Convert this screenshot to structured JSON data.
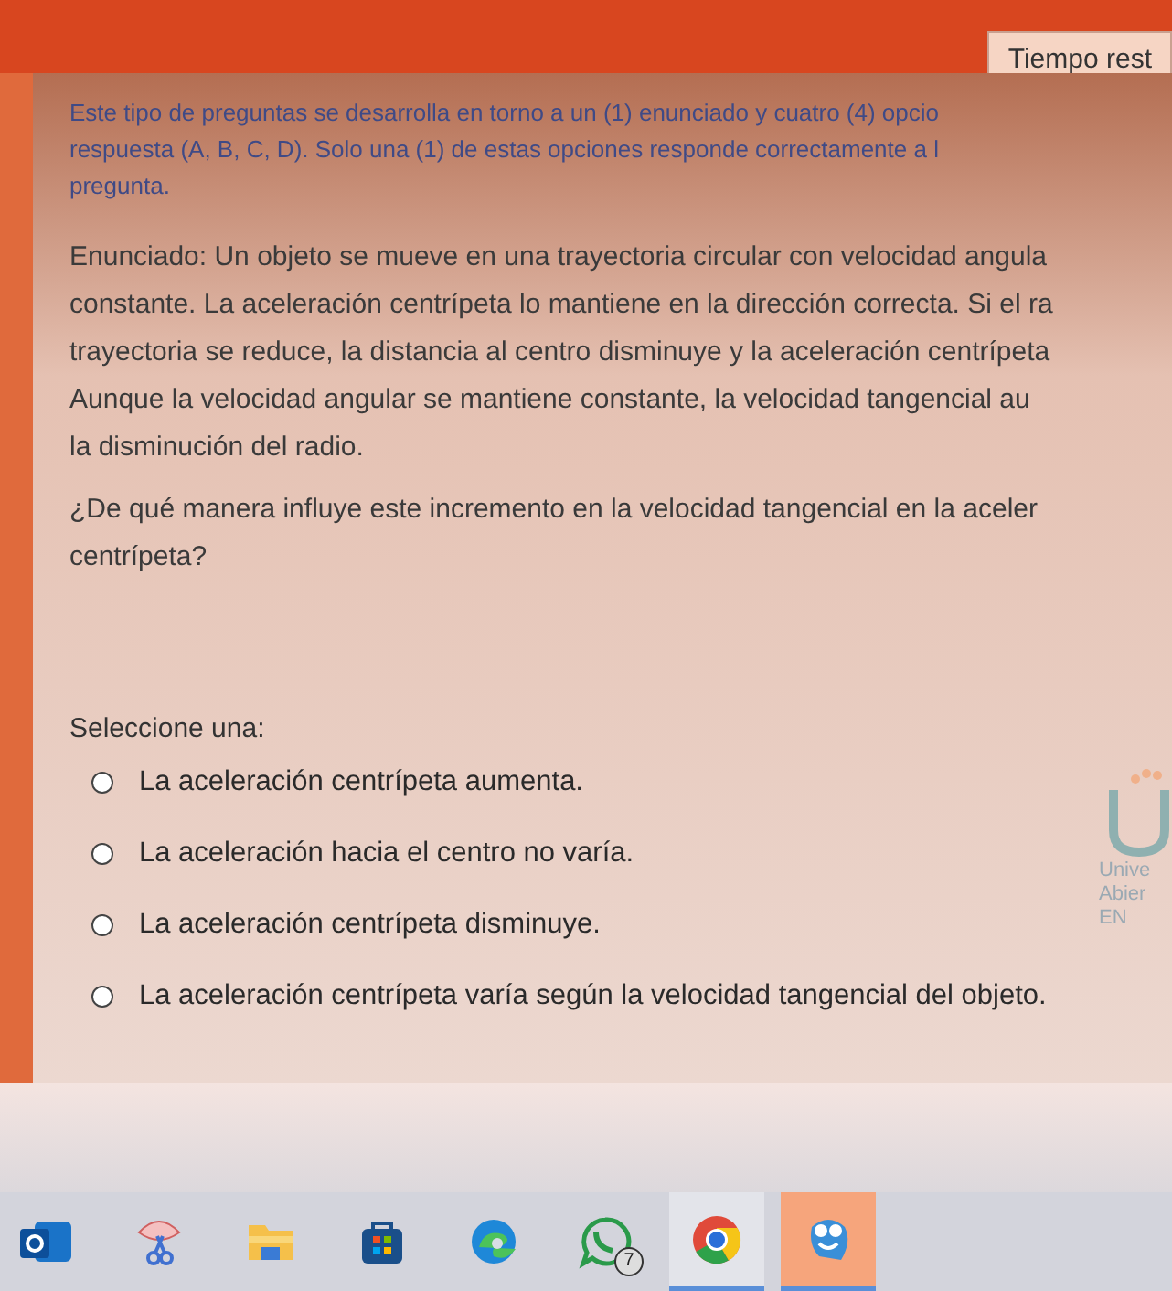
{
  "header": {
    "timer_label": "Tiempo rest"
  },
  "instructions": [
    "Este tipo de preguntas se desarrolla en torno a un (1) enunciado y cuatro (4) opcio",
    "respuesta (A, B, C, D). Solo una (1) de estas opciones responde correctamente a l",
    "pregunta."
  ],
  "statement": [
    "Enunciado: Un objeto se mueve en una trayectoria circular con velocidad angula",
    "constante. La aceleración centrípeta lo mantiene en la dirección correcta. Si el ra",
    "trayectoria se reduce, la distancia al centro disminuye y la aceleración centrípeta",
    "Aunque la velocidad angular se mantiene constante, la velocidad tangencial au",
    "la disminución del radio."
  ],
  "question": [
    "¿De qué manera influye este incremento en la velocidad tangencial en la aceler",
    "centrípeta?"
  ],
  "prompt": "Seleccione una:",
  "options": [
    {
      "label": "La aceleración centrípeta aumenta.",
      "selected": false
    },
    {
      "label": "La aceleración hacia el centro no varía.",
      "selected": false
    },
    {
      "label": "La aceleración centrípeta disminuye.",
      "selected": false
    },
    {
      "label": "La aceleración centrípeta varía según la velocidad tangencial del objeto.",
      "selected": false
    }
  ],
  "logo": {
    "lines": [
      "Unive",
      "Abier",
      "EN"
    ]
  },
  "taskbar": [
    {
      "kind": "outlook",
      "active": false,
      "running": false
    },
    {
      "kind": "snip",
      "active": false,
      "running": false
    },
    {
      "kind": "folder",
      "active": false,
      "running": false
    },
    {
      "kind": "store",
      "active": false,
      "running": false
    },
    {
      "kind": "edge",
      "active": false,
      "running": false
    },
    {
      "kind": "whatsapp",
      "active": false,
      "running": false,
      "badge": "7"
    },
    {
      "kind": "chrome",
      "active": false,
      "running": true
    },
    {
      "kind": "mascot",
      "active": true,
      "running": true
    }
  ]
}
